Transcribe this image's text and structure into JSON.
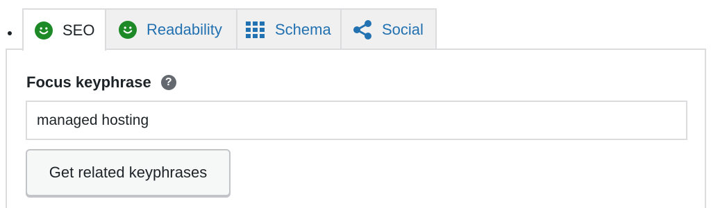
{
  "tabs": [
    {
      "label": "SEO",
      "icon": "smiley-face-icon",
      "active": true
    },
    {
      "label": "Readability",
      "icon": "smiley-face-icon",
      "active": false
    },
    {
      "label": "Schema",
      "icon": "grid-icon",
      "active": false
    },
    {
      "label": "Social",
      "icon": "share-icon",
      "active": false
    }
  ],
  "panel": {
    "focus_label": "Focus keyphrase",
    "help_glyph": "?",
    "keyphrase_value": "managed hosting",
    "related_button_label": "Get related keyphrases"
  },
  "colors": {
    "good_score": "#1e8a27",
    "link_blue": "#2271b1",
    "text_dark": "#1d2327",
    "border": "#dcdcde"
  }
}
